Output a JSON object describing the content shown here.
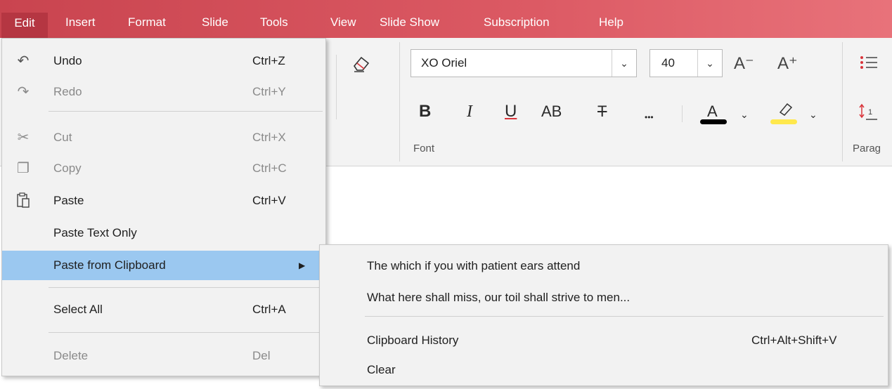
{
  "menubar": {
    "items": [
      "Edit",
      "Insert",
      "Format",
      "Slide",
      "Tools",
      "View",
      "Slide Show",
      "Subscription",
      "Help"
    ]
  },
  "toolbar": {
    "font_name": "XO Oriel",
    "font_size": "40",
    "font_group_label": "Font",
    "paragraph_group_label": "Parag",
    "underline_color": "#d9343a",
    "text_color_bar": "#000000",
    "highlight_color_bar": "#ffe84d",
    "icons": [
      "eraser-icon",
      "grow-font-icon",
      "shrink-font-icon",
      "bold-icon",
      "italic-icon",
      "underline-icon",
      "all-caps-icon",
      "strikethrough-icon",
      "more-icon",
      "font-color-icon",
      "highlight-icon",
      "bullet-list-icon",
      "line-spacing-icon"
    ],
    "grow_glyph": "A⁺",
    "shrink_glyph": "A⁻",
    "bold_glyph": "B",
    "italic_glyph": "I",
    "underline_glyph": "U",
    "caps_glyph": "AB",
    "strike_glyph": "T",
    "more_glyph": "•••",
    "color_glyph": "A"
  },
  "edit_menu": {
    "items": [
      {
        "label": "Undo",
        "shortcut": "Ctrl+Z",
        "icon": "undo-icon",
        "enabled": true
      },
      {
        "label": "Redo",
        "shortcut": "Ctrl+Y",
        "icon": "redo-icon",
        "enabled": false
      },
      {
        "label": "Cut",
        "shortcut": "Ctrl+X",
        "icon": "cut-icon",
        "enabled": false
      },
      {
        "label": "Copy",
        "shortcut": "Ctrl+C",
        "icon": "copy-icon",
        "enabled": false
      },
      {
        "label": "Paste",
        "shortcut": "Ctrl+V",
        "icon": "paste-icon",
        "enabled": true
      },
      {
        "label": "Paste Text Only",
        "shortcut": "",
        "enabled": true
      },
      {
        "label": "Paste from Clipboard",
        "shortcut": "",
        "enabled": true,
        "highlighted": true,
        "submenu": true
      },
      {
        "label": "Select All",
        "shortcut": "Ctrl+A",
        "enabled": true
      },
      {
        "label": "Delete",
        "shortcut": "Del",
        "enabled": false
      }
    ],
    "highlight_color": "#9bc8f0"
  },
  "clipboard_submenu": {
    "items": [
      {
        "label": "The which if you with patient ears attend"
      },
      {
        "label": "What here shall miss, our toil shall strive to men..."
      },
      {
        "label": "Clipboard History",
        "shortcut": "Ctrl+Alt+Shift+V"
      },
      {
        "label": "Clear"
      }
    ]
  },
  "colors": {
    "menubar_bg": "#d34e59",
    "menubar_active": "#b53642",
    "menu_bg": "#f2f2f2"
  }
}
